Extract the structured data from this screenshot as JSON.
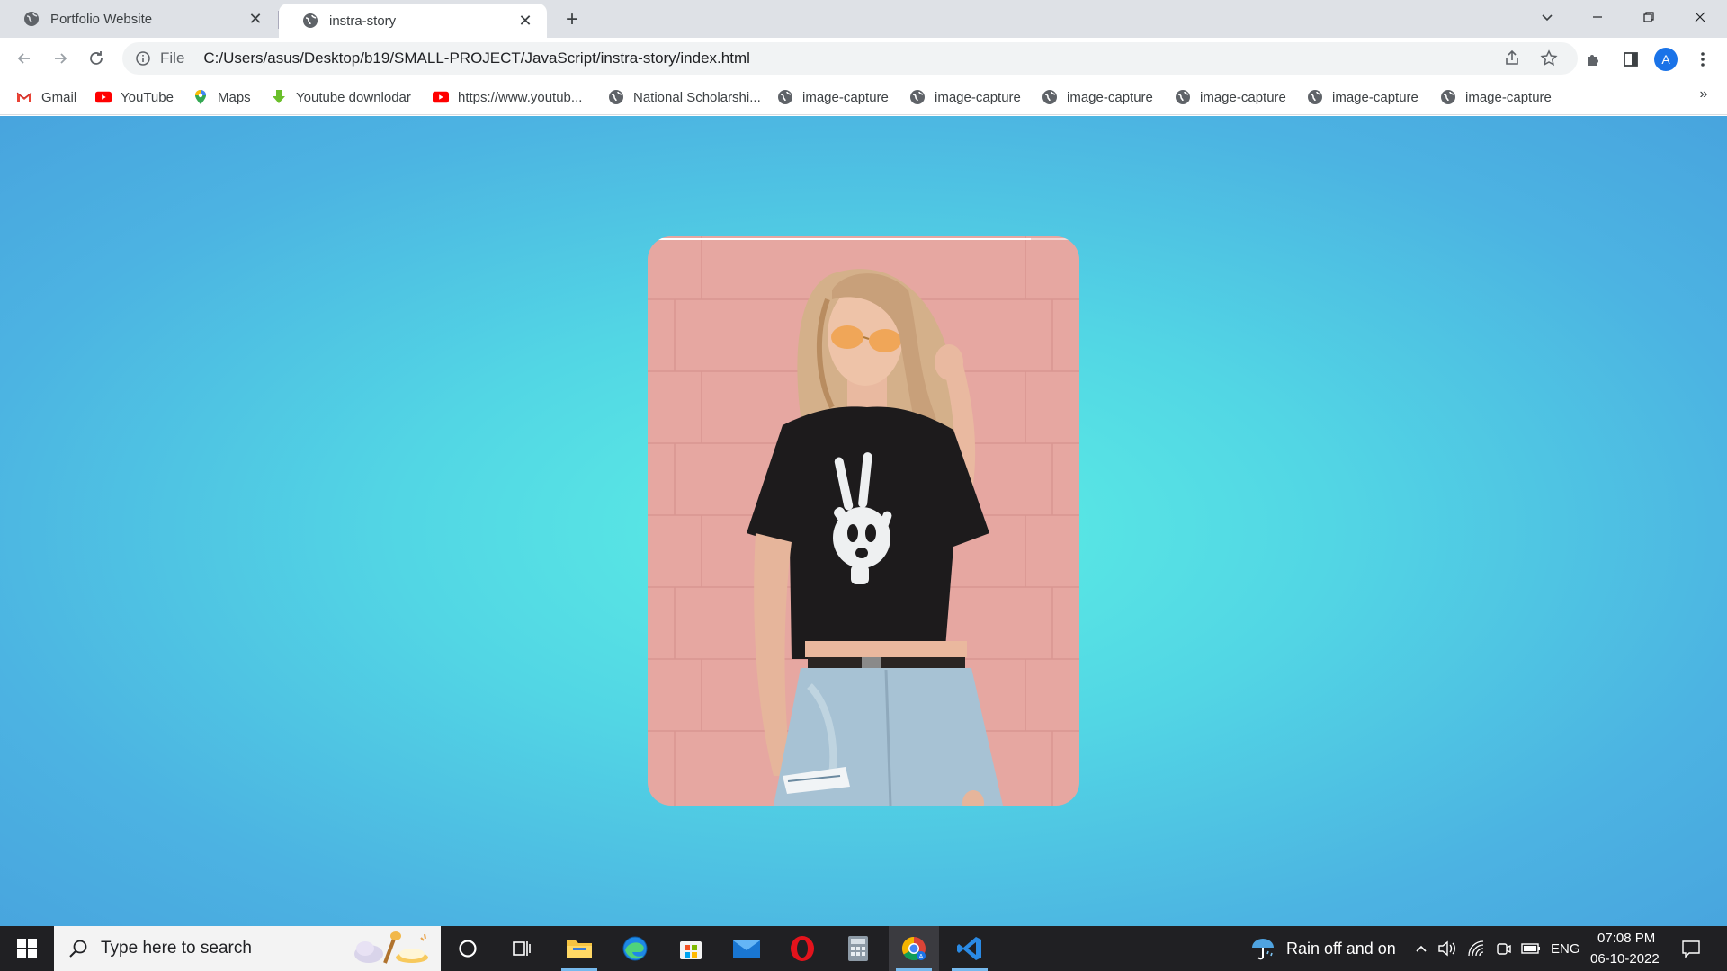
{
  "browser": {
    "tabs": [
      {
        "title": "Portfolio Website",
        "close": "✕",
        "active": false
      },
      {
        "title": "instra-story",
        "close": "✕",
        "active": true
      }
    ],
    "new_tab": "+",
    "address": {
      "scheme_label": "File",
      "url": "C:/Users/asus/Desktop/b19/SMALL-PROJECT/JavaScript/instra-story/index.html"
    },
    "profile_initial": "A"
  },
  "bookmarks": [
    {
      "label": "Gmail",
      "icon": "gmail-icon"
    },
    {
      "label": "YouTube",
      "icon": "youtube-icon"
    },
    {
      "label": "Maps",
      "icon": "maps-icon"
    },
    {
      "label": "Youtube downlodar",
      "icon": "download-icon"
    },
    {
      "label": "https://www.youtub...",
      "icon": "youtube-icon"
    },
    {
      "label": "National Scholarshi...",
      "icon": "globe-icon"
    },
    {
      "label": "image-capture",
      "icon": "globe-icon"
    },
    {
      "label": "image-capture",
      "icon": "globe-icon"
    },
    {
      "label": "image-capture",
      "icon": "globe-icon"
    },
    {
      "label": "image-capture",
      "icon": "globe-icon"
    },
    {
      "label": "image-capture",
      "icon": "globe-icon"
    },
    {
      "label": "image-capture",
      "icon": "globe-icon"
    }
  ],
  "bookmarks_overflow": "»",
  "page": {
    "story": {
      "image_alt": "girl-photo",
      "progress_done": 0.9,
      "segments": 2
    }
  },
  "taskbar": {
    "search_placeholder": "Type here to search",
    "weather": "Rain off and on",
    "language": "ENG",
    "time": "07:08 PM",
    "date": "06-10-2022"
  },
  "colors": {
    "bg_center": "#5cf0e3",
    "bg_edge": "#48a4de",
    "wall": "#e7a7a2",
    "shirt": "#1d1b1c",
    "jeans": "#a9c3d4",
    "hair": "#d8b58f"
  }
}
